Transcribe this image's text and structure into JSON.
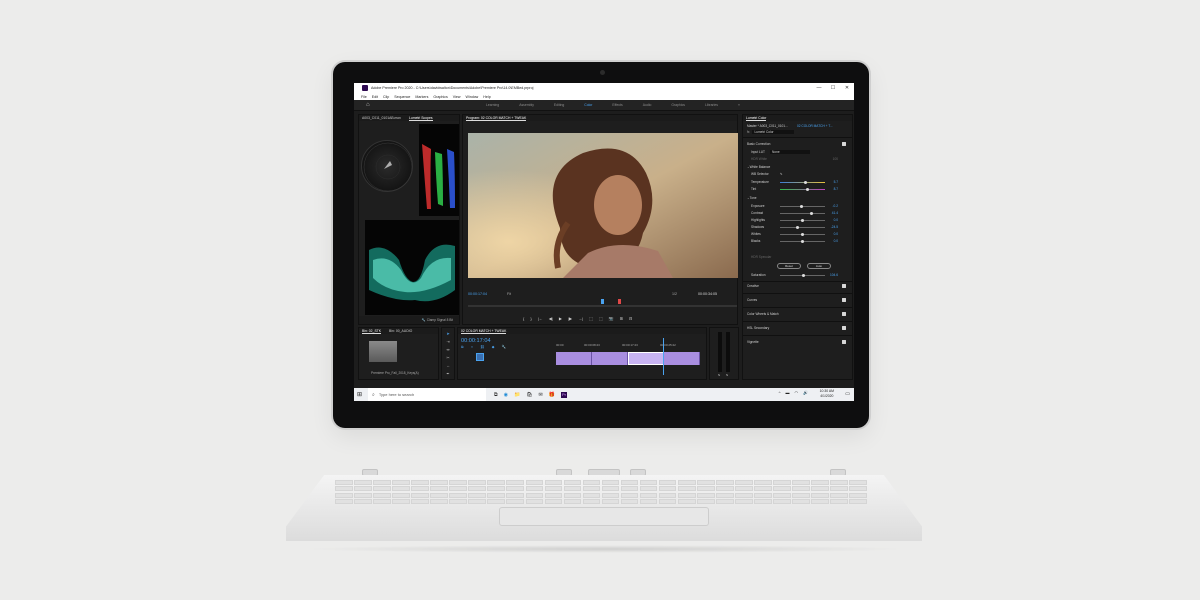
{
  "window": {
    "title": "Adobe Premiere Pro 2020 - C:\\Users\\davidwalton\\Documents\\Adobe\\Premiere Pro\\14.0\\EMBed.prproj",
    "minimize": "—",
    "maximize": "☐",
    "close": "✕"
  },
  "menu": [
    "File",
    "Edit",
    "Clip",
    "Sequence",
    "Markers",
    "Graphics",
    "View",
    "Window",
    "Help"
  ],
  "workspaces": {
    "items": [
      "Learning",
      "Assembly",
      "Editing",
      "Color",
      "Effects",
      "Audio",
      "Graphics",
      "Libraries"
    ],
    "active": "Color",
    "more": "»"
  },
  "scopes": {
    "tabs": [
      "A003_C011_0101AB.mov",
      "Lumetri Scopes"
    ],
    "active_tab": "Lumetri Scopes",
    "footer": "Clamp Signal   8 Bit"
  },
  "program": {
    "title": "Program: 02 COLOR MATCH + TWEAK",
    "timecode": "00:00:17:04",
    "fit": "Fit",
    "ratio": "1/2",
    "duration": "00:00:34:05",
    "transport": [
      "{",
      "}",
      "|←",
      "◀|",
      "▶",
      "|▶",
      "→|",
      "⬚",
      "⬚",
      "📷",
      "⊞",
      "⊟"
    ]
  },
  "lumetri": {
    "title": "Lumetri Color",
    "master": "Master * A003_C011_0101...",
    "sequence": "02 COLOR MATCH + T...",
    "fx": "fx",
    "preset": "Lumetri Color",
    "sections": {
      "basic": "Basic Correction",
      "input_lut_label": "Input LUT",
      "input_lut_value": "None",
      "hdr_white": "HDR White",
      "hdr_value": "100",
      "white_balance": "White Balance",
      "wb_selector": "WB Selector",
      "tone": "Tone",
      "creative": "Creative",
      "curves": "Curves",
      "wheels": "Color Wheels & Match",
      "hsl": "HSL Secondary",
      "vignette": "Vignette"
    },
    "sliders": [
      {
        "label": "Temperature",
        "value": "5.7",
        "pos": 0.57
      },
      {
        "label": "Tint",
        "value": "8.7",
        "pos": 0.6
      },
      {
        "label": "Exposure",
        "value": "-0.2",
        "pos": 0.48
      },
      {
        "label": "Contrast",
        "value": "41.4",
        "pos": 0.7
      },
      {
        "label": "Highlights",
        "value": "0.0",
        "pos": 0.5
      },
      {
        "label": "Shadows",
        "value": "-24.5",
        "pos": 0.38
      },
      {
        "label": "Whites",
        "value": "0.0",
        "pos": 0.5
      },
      {
        "label": "Blacks",
        "value": "0.0",
        "pos": 0.5
      }
    ],
    "hdr_specular": "HDR Specular",
    "reset": "Reset",
    "auto": "Auto",
    "saturation_label": "Saturation",
    "saturation_value": "104.6",
    "saturation_pos": 0.52
  },
  "project": {
    "tabs": [
      "Bin: 02_STK",
      "Bin: 00_AUDIO"
    ],
    "file": "Premiere Pro_Fall_2018_Keys(A)"
  },
  "timeline": {
    "title": "02 COLOR MATCH + TWEAK",
    "timecode": "00:00:17:04",
    "ticks": [
      "00:00",
      "00:00:08:23",
      "00:00:17:23",
      "00:00:25:22"
    ],
    "clip_count": 4,
    "selected_clip": 3,
    "playhead": 0.74
  },
  "meters": {
    "labels": [
      "S",
      "S"
    ]
  },
  "taskbar": {
    "search_placeholder": "Type here to search",
    "time": "10:30 AM",
    "date": "4/1/2020",
    "apps": [
      "⧉",
      "◉",
      "📁",
      "🛍",
      "✉",
      "🎁",
      "Pr"
    ]
  }
}
